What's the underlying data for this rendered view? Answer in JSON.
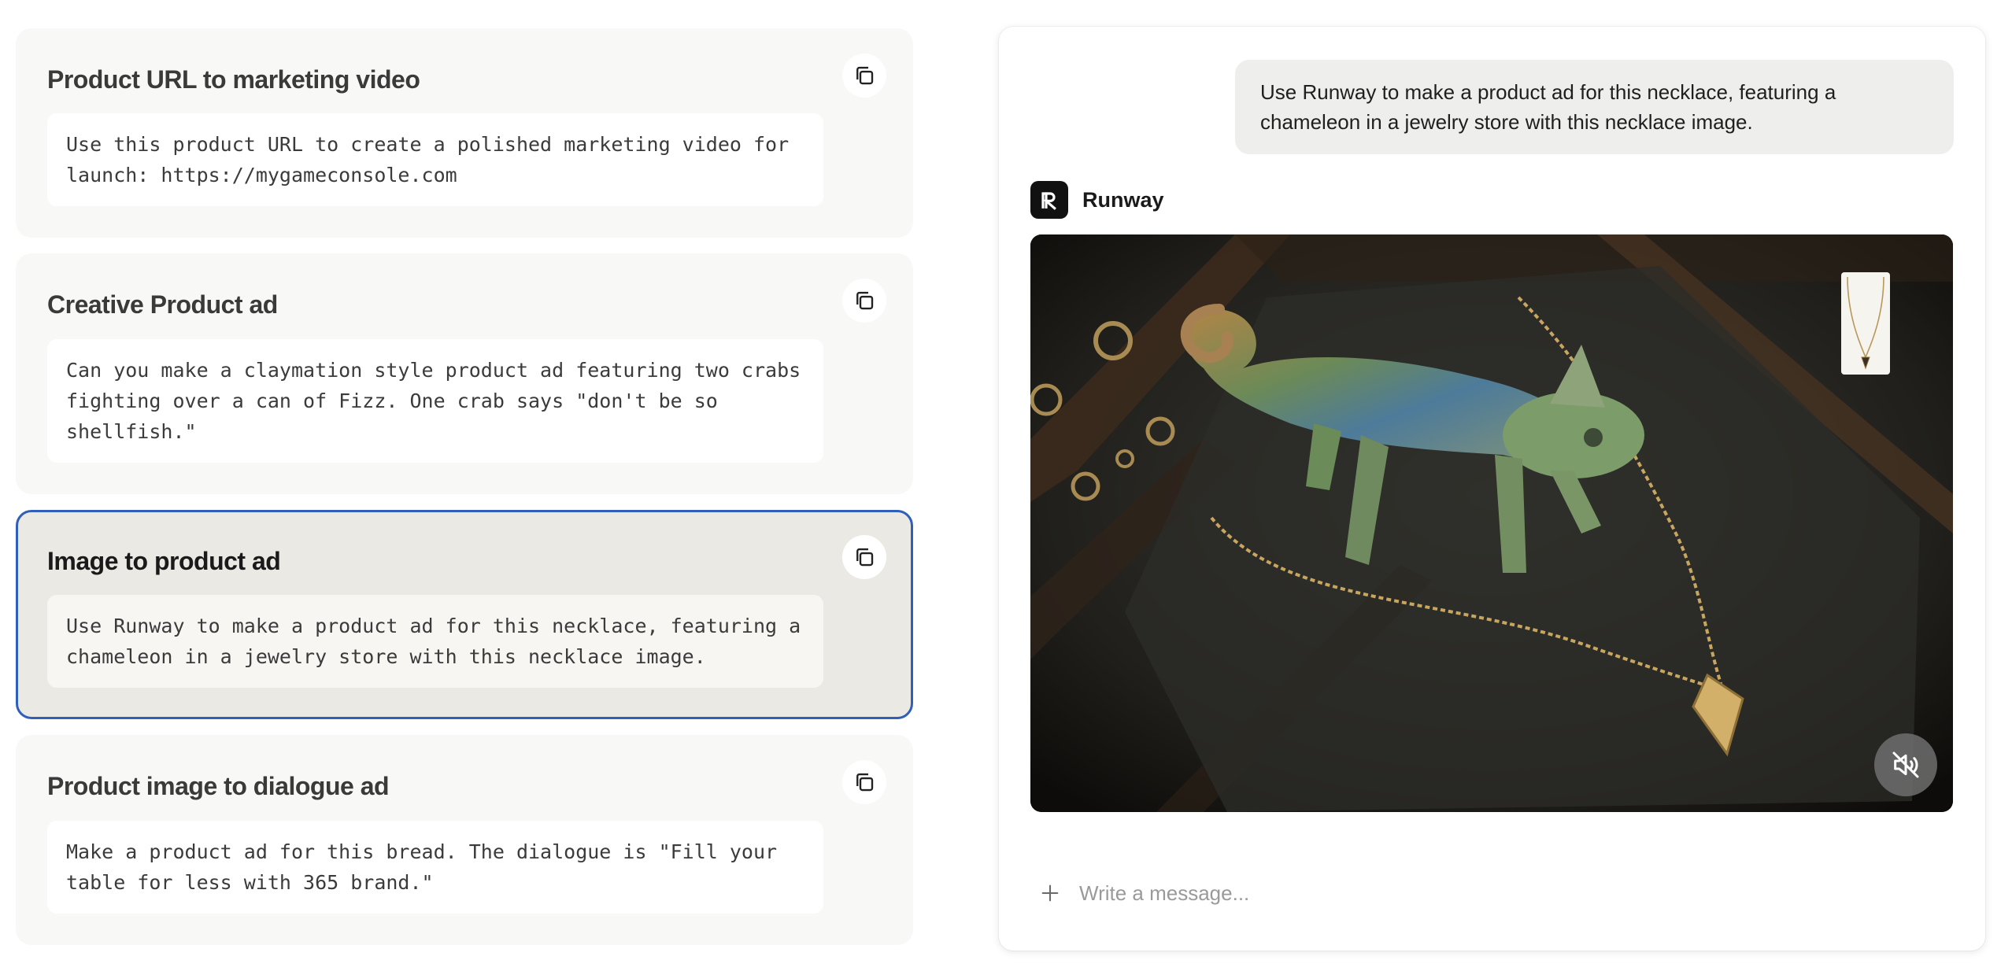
{
  "cards": [
    {
      "title": "Product URL to marketing video",
      "prompt": "Use this product URL to create a polished marketing video for launch: https://mygameconsole.com"
    },
    {
      "title": "Creative Product ad",
      "prompt": "Can you make a claymation style product ad featuring two crabs fighting over a can of Fizz. One crab says \"don't be so shellfish.\""
    },
    {
      "title": "Image to product ad",
      "prompt": "Use Runway to make a product ad for this necklace, featuring a chameleon in a jewelry store with this necklace image.",
      "selected": true
    },
    {
      "title": "Product image to dialogue ad",
      "prompt": "Make a product ad for this bread. The dialogue is \"Fill your table for less with 365 brand.\""
    }
  ],
  "chat": {
    "user_message": "Use Runway to make a product ad for this necklace, featuring a chameleon in a jewelry store with this necklace image.",
    "assistant_name": "Runway",
    "composer_placeholder": "Write a message..."
  },
  "icons": {
    "copy": "copy-icon",
    "assistant_logo": "runway-logo-icon",
    "mute": "speaker-muted-icon",
    "add": "plus-icon"
  },
  "colors": {
    "selected_border": "#2f5fb8",
    "card_bg": "#f8f8f6",
    "selected_card_bg": "#ebe9e4",
    "bubble_bg": "#eeeeec"
  }
}
